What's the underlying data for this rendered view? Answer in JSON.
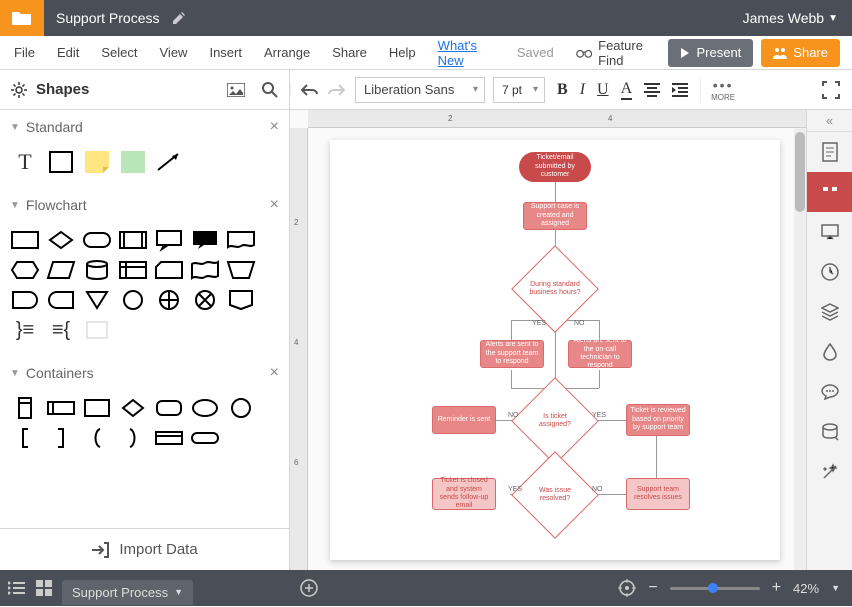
{
  "titlebar": {
    "doc_title": "Support Process",
    "user_name": "James Webb"
  },
  "menubar": {
    "items": [
      "File",
      "Edit",
      "Select",
      "View",
      "Insert",
      "Arrange",
      "Share",
      "Help"
    ],
    "whats_new": "What's New",
    "saved": "Saved",
    "feature_find": "Feature Find",
    "present": "Present",
    "share": "Share"
  },
  "toolbar": {
    "shapes_label": "Shapes",
    "font": "Liberation Sans",
    "font_size": "7 pt",
    "more": "MORE"
  },
  "panels": {
    "standard": "Standard",
    "flowchart": "Flowchart",
    "containers": "Containers",
    "import_data": "Import Data"
  },
  "ruler": {
    "h": [
      "2",
      "4"
    ],
    "v": [
      "2",
      "4",
      "6"
    ]
  },
  "flowchart": {
    "n1": "Ticket/email submitted by customer",
    "n2": "Support case is created and assigned",
    "d1": "During standard business hours?",
    "n3": "Alerts are sent to the support team to respond",
    "n4": "Alerts are sent to the on-call technician to respond",
    "d2": "Is ticket assigned?",
    "n5": "Reminder is sent",
    "n6": "Ticket is reviewed based on priority by support team",
    "d3": "Was issue resolved?",
    "n7": "Ticket is closed and system sends follow-up email",
    "n8": "Support team resolves issues",
    "yes": "YES",
    "no": "NO"
  },
  "statusbar": {
    "page_tab": "Support Process",
    "zoom": "42%"
  }
}
